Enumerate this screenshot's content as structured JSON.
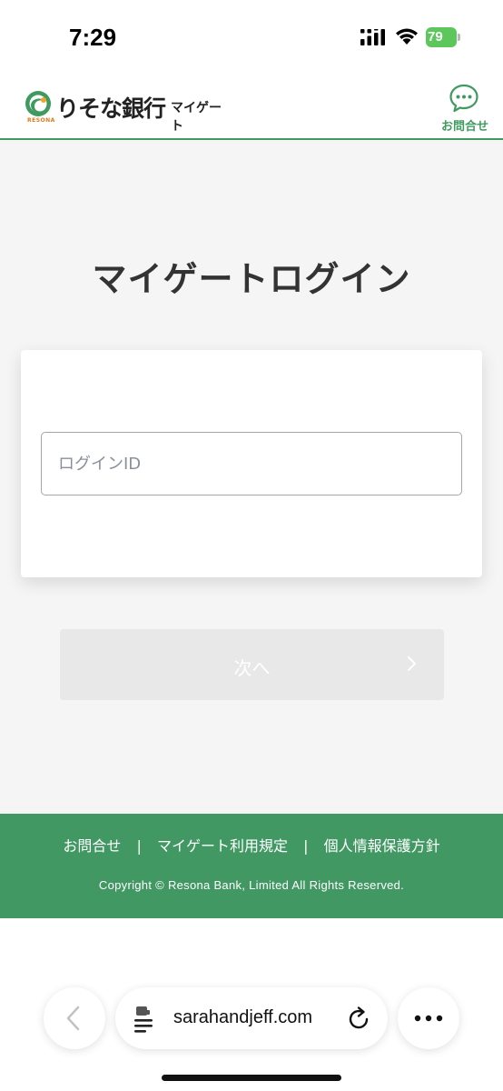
{
  "status_bar": {
    "time": "7:29",
    "battery": "79"
  },
  "header": {
    "logo_name": "りそな銀行",
    "logo_sub": "RESONA",
    "product": "マイゲート",
    "contact_label": "お問合せ",
    "icons": {
      "logo": "resona-logo-icon",
      "chat": "chat-bubble-icon"
    }
  },
  "main": {
    "title": "マイゲートログイン",
    "login_id_placeholder": "ログインID",
    "next_label": "次へ"
  },
  "footer": {
    "links": [
      "お問合せ",
      "マイゲート利用規定",
      "個人情報保護方針"
    ],
    "separator": "|",
    "copyright": "Copyright © Resona Bank, Limited All Rights Reserved."
  },
  "browser": {
    "url": "sarahandjeff.com"
  },
  "colors": {
    "brand_green": "#419863",
    "header_border": "#3f9a60",
    "button_disabled": "#e8e8e8",
    "background": "#f5f5f5"
  }
}
